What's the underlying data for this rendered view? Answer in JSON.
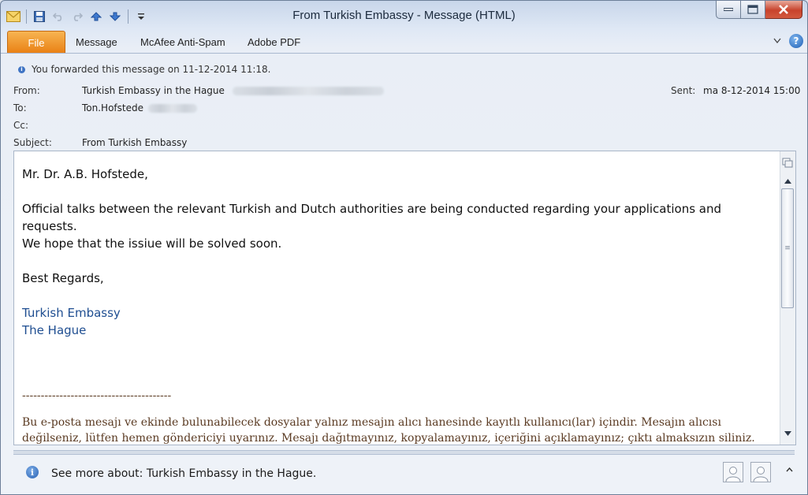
{
  "window": {
    "title": "From Turkish Embassy",
    "title_suffix": "Message (HTML)"
  },
  "ribbon": {
    "file_tab": "File",
    "tabs": [
      "Message",
      "McAfee Anti-Spam",
      "Adobe PDF"
    ]
  },
  "header": {
    "info": "You forwarded this message on 11-12-2014 11:18.",
    "from_label": "From:",
    "from_value": "Turkish Embassy in the Hague",
    "to_label": "To:",
    "to_value": "Ton.Hofstede",
    "cc_label": "Cc:",
    "subject_label": "Subject:",
    "subject_value": "From Turkish Embassy",
    "sent_label": "Sent:",
    "sent_value": "ma 8-12-2014 15:00"
  },
  "message": {
    "greeting": "Mr. Dr. A.B. Hofstede,",
    "line1": "Official talks between the relevant Turkish and Dutch authorities are being conducted regarding your applications and requests.",
    "line2": "We hope that the issiue will be solved soon.",
    "closing": "Best Regards,",
    "sig1": "Turkish Embassy",
    "sig2": "The Hague",
    "separator": "----------------------------------------",
    "disclaimer1": "Bu e-posta mesajı ve ekinde bulunabilecek dosyalar yalnız mesajın alıcı hanesinde kayıtlı kullanıcı(lar) içindir. Mesajın alıcısı",
    "disclaimer2": "değilseniz, lütfen hemen göndericiyi uyarınız. Mesajı dağıtmayınız, kopyalamayınız, içeriğini açıklamayınız; çıktı almaksızın siliniz."
  },
  "people_pane": {
    "text": "See more about: Turkish Embassy in the Hague."
  },
  "colors": {
    "file_tab": "#e97f13",
    "signature": "#1f4e91",
    "close_button": "#c8432c"
  }
}
